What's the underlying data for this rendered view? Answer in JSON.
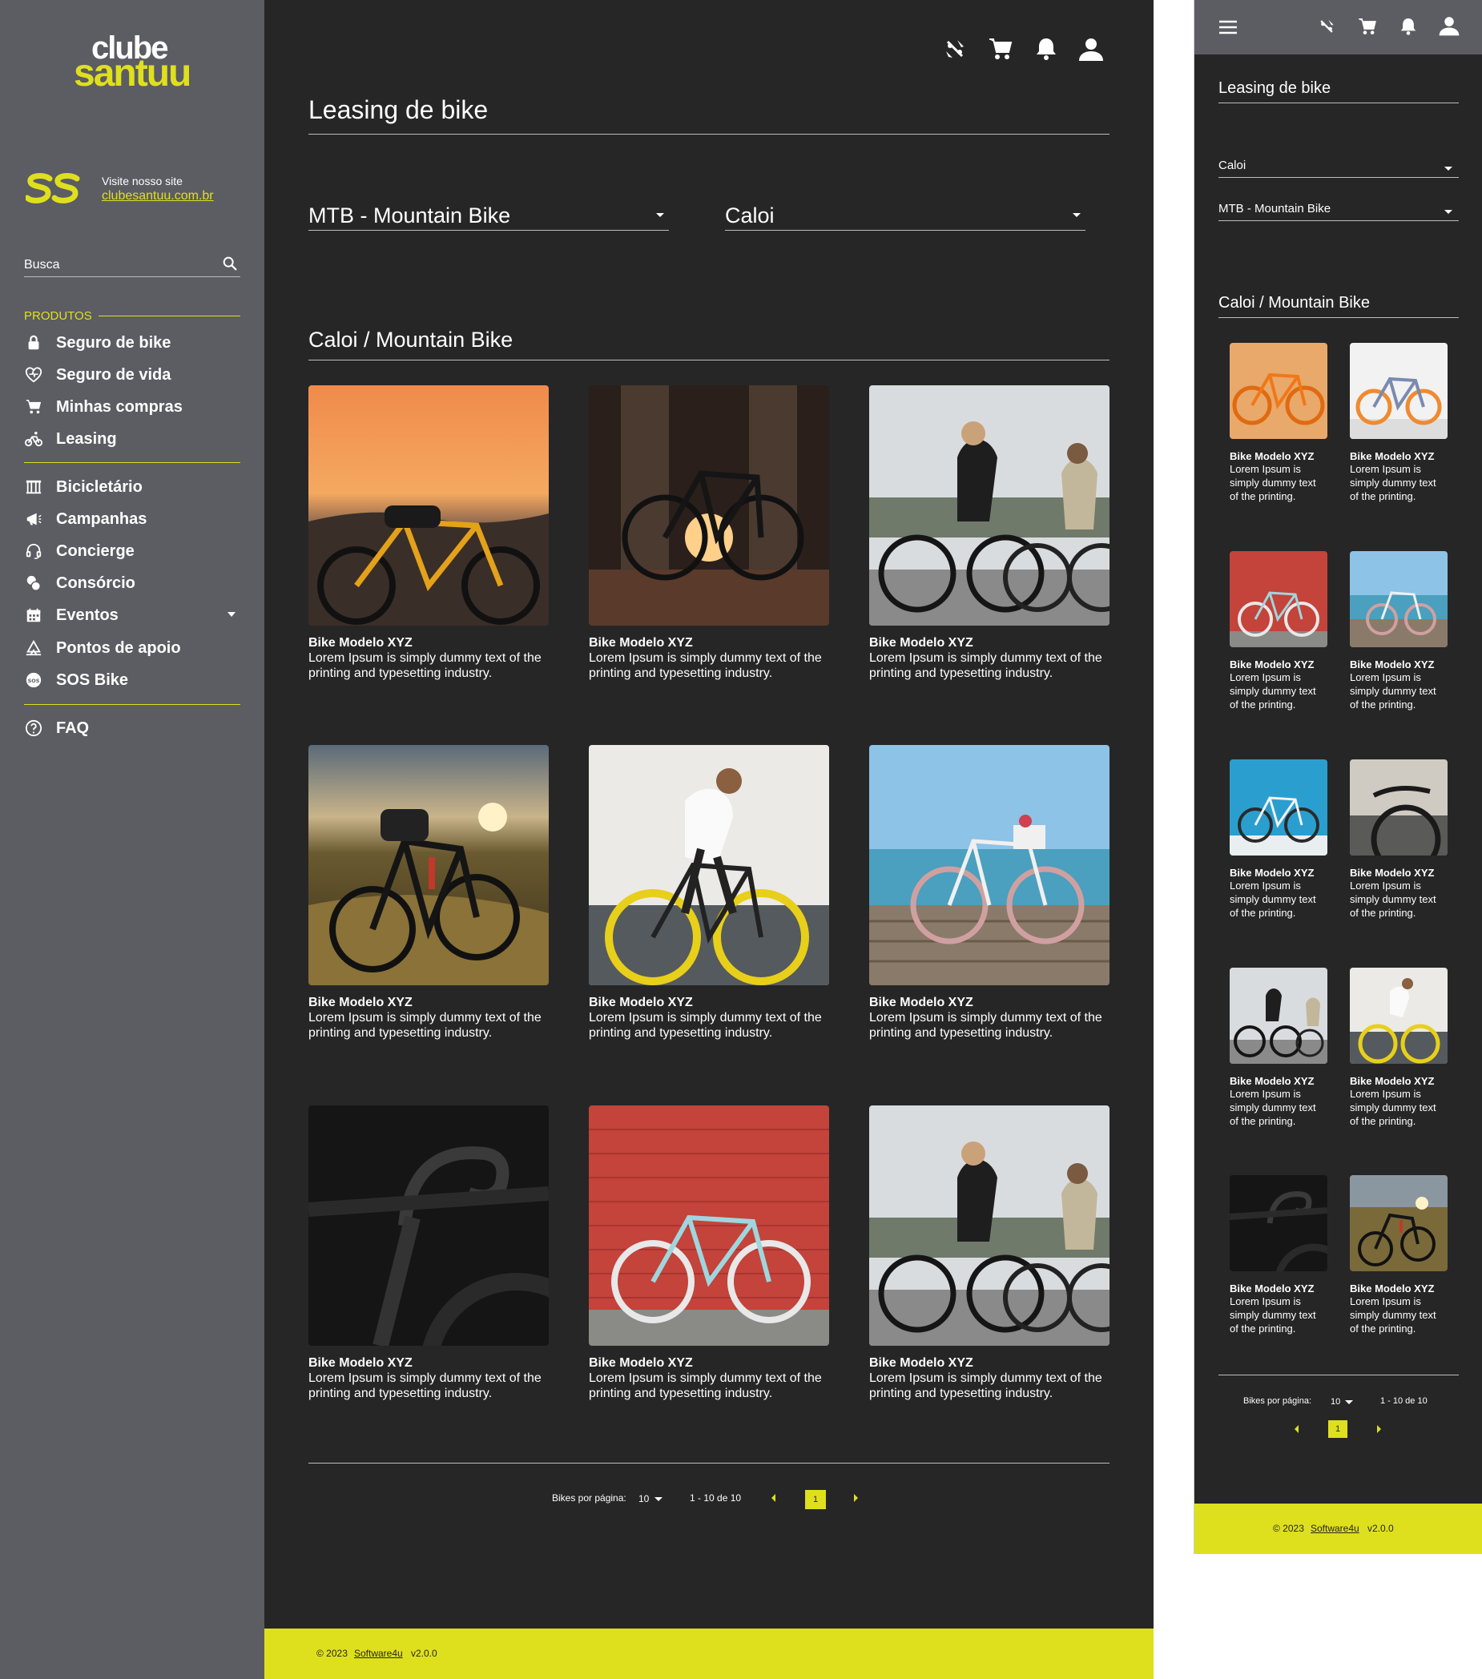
{
  "brand": {
    "logo_top": "clube",
    "logo_bottom": "santuu",
    "accent": "#dfe01d",
    "sidebar_bg": "#5c5c63",
    "main_bg": "#262626"
  },
  "sidebar": {
    "visit_label": "Visite nosso site",
    "visit_link": "clubesantuu.com.br",
    "search_label": "Busca",
    "section_label": "PRODUTOS",
    "items": [
      {
        "label": "Seguro de bike",
        "icon": "lock-icon"
      },
      {
        "label": "Seguro de vida",
        "icon": "life-icon"
      },
      {
        "label": "Minhas compras",
        "icon": "cart-icon"
      },
      {
        "label": "Leasing",
        "icon": "bike-icon"
      },
      {
        "label": "Bicicletário",
        "icon": "bike-rack-icon"
      },
      {
        "label": "Campanhas",
        "icon": "megaphone-icon"
      },
      {
        "label": "Concierge",
        "icon": "headset-icon"
      },
      {
        "label": "Consórcio",
        "icon": "coins-icon"
      },
      {
        "label": "Eventos",
        "icon": "calendar-icon"
      },
      {
        "label": "Pontos de apoio",
        "icon": "support-point-icon"
      },
      {
        "label": "SOS Bike",
        "icon": "sos-icon"
      },
      {
        "label": "FAQ",
        "icon": "help-icon"
      }
    ]
  },
  "main": {
    "title": "Leasing de bike",
    "filter_category": "MTB - Mountain Bike",
    "filter_brand": "Caloi",
    "section_title": "Caloi / Mountain Bike",
    "products": [
      {
        "title": "Bike Modelo XYZ",
        "desc": "Lorem Ipsum is simply dummy text of the printing and typesetting industry.",
        "image": "sunset-mtb"
      },
      {
        "title": "Bike Modelo XYZ",
        "desc": "Lorem Ipsum is simply dummy text of the printing and typesetting industry.",
        "image": "backlit-bike"
      },
      {
        "title": "Bike Modelo XYZ",
        "desc": "Lorem Ipsum is simply dummy text of the printing and typesetting industry.",
        "image": "two-cyclists"
      },
      {
        "title": "Bike Modelo XYZ",
        "desc": "Lorem Ipsum is simply dummy text of the printing and typesetting industry.",
        "image": "field-bike"
      },
      {
        "title": "Bike Modelo XYZ",
        "desc": "Lorem Ipsum is simply dummy text of the printing and typesetting industry.",
        "image": "yellow-fixie"
      },
      {
        "title": "Bike Modelo XYZ",
        "desc": "Lorem Ipsum is simply dummy text of the printing and typesetting industry.",
        "image": "beach-cruiser"
      },
      {
        "title": "Bike Modelo XYZ",
        "desc": "Lorem Ipsum is simply dummy text of the printing and typesetting industry.",
        "image": "dark-handlebar"
      },
      {
        "title": "Bike Modelo XYZ",
        "desc": "Lorem Ipsum is simply dummy text of the printing and typesetting industry.",
        "image": "red-wall-bike"
      },
      {
        "title": "Bike Modelo XYZ",
        "desc": "Lorem Ipsum is simply dummy text of the printing and typesetting industry.",
        "image": "two-cyclists"
      }
    ],
    "pagination": {
      "per_page_label": "Bikes por página:",
      "per_page": "10",
      "range": "1 - 10 de 10",
      "current_page": "1"
    }
  },
  "footer": {
    "prefix": "© 2023",
    "link": "Software4u",
    "suffix": "v2.0.0"
  },
  "mobile": {
    "title": "Leasing de bike",
    "filter_brand": "Caloi",
    "filter_category": "MTB - Mountain Bike",
    "section_title": "Caloi / Mountain Bike",
    "products": [
      {
        "title": "Bike Modelo XYZ",
        "desc": "Lorem Ipsum is simply dummy text of the printing.",
        "image": "orange-mtb"
      },
      {
        "title": "Bike Modelo XYZ",
        "desc": "Lorem Ipsum is simply dummy text of the printing.",
        "image": "white-road-bike"
      },
      {
        "title": "Bike Modelo XYZ",
        "desc": "Lorem Ipsum is simply dummy text of the printing.",
        "image": "red-wall-bike"
      },
      {
        "title": "Bike Modelo XYZ",
        "desc": "Lorem Ipsum is simply dummy text of the printing.",
        "image": "beach-cruiser"
      },
      {
        "title": "Bike Modelo XYZ",
        "desc": "Lorem Ipsum is simply dummy text of the printing.",
        "image": "blue-wall-bike"
      },
      {
        "title": "Bike Modelo XYZ",
        "desc": "Lorem Ipsum is simply dummy text of the printing.",
        "image": "city-bike"
      },
      {
        "title": "Bike Modelo XYZ",
        "desc": "Lorem Ipsum is simply dummy text of the printing.",
        "image": "two-cyclists"
      },
      {
        "title": "Bike Modelo XYZ",
        "desc": "Lorem Ipsum is simply dummy text of the printing.",
        "image": "yellow-fixie"
      },
      {
        "title": "Bike Modelo XYZ",
        "desc": "Lorem Ipsum is simply dummy text of the printing.",
        "image": "dark-handlebar"
      },
      {
        "title": "Bike Modelo XYZ",
        "desc": "Lorem Ipsum is simply dummy text of the printing.",
        "image": "field-bike"
      }
    ],
    "pagination": {
      "per_page_label": "Bikes por página:",
      "per_page": "10",
      "range": "1 - 10 de 10",
      "current_page": "1"
    }
  }
}
